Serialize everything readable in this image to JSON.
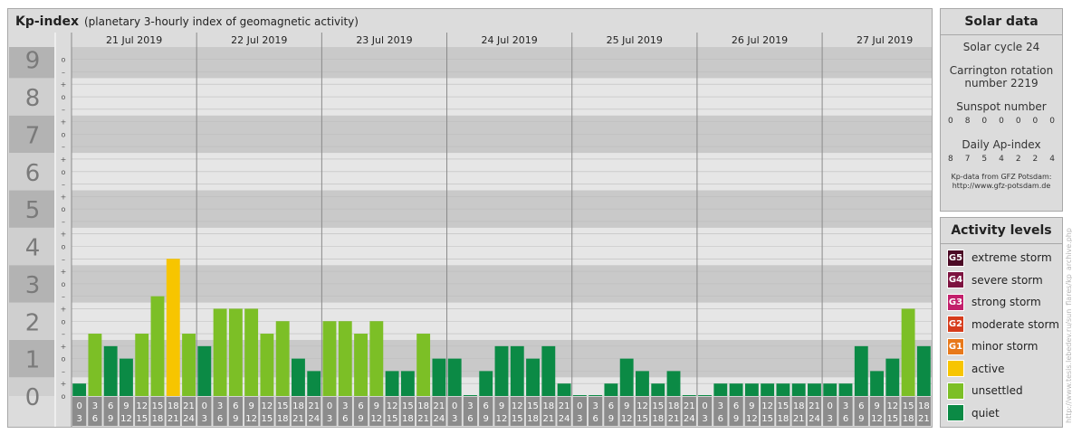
{
  "header": {
    "title": "Kp-index",
    "subtitle": "(planetary 3-hourly index of geomagnetic activity)"
  },
  "chart_data": {
    "type": "bar",
    "y_ticks": [
      "0",
      "1",
      "2",
      "3",
      "4",
      "5",
      "6",
      "7",
      "8",
      "9"
    ],
    "y_minor_labels": [
      "o",
      "+",
      "–"
    ],
    "ylim": [
      0,
      9.33
    ],
    "days": [
      "21 Jul 2019",
      "22 Jul 2019",
      "23 Jul 2019",
      "24 Jul 2019",
      "25 Jul 2019",
      "26 Jul 2019",
      "27 Jul 2019"
    ],
    "bin_start_labels": [
      "0",
      "3",
      "6",
      "9",
      "12",
      "15",
      "18",
      "21"
    ],
    "bin_end_labels": [
      "3",
      "6",
      "9",
      "12",
      "15",
      "18",
      "21",
      "24"
    ],
    "values": [
      0.333,
      1.667,
      1.333,
      1.0,
      1.667,
      2.667,
      3.667,
      1.667,
      1.333,
      2.333,
      2.333,
      2.333,
      1.667,
      2.0,
      1.0,
      0.667,
      2.0,
      2.0,
      1.667,
      2.0,
      0.667,
      0.667,
      1.667,
      1.0,
      1.0,
      0.0,
      0.667,
      1.333,
      1.333,
      1.0,
      1.333,
      0.333,
      0.0,
      0.0,
      0.333,
      1.0,
      0.667,
      0.333,
      0.667,
      0.0,
      0.0,
      0.333,
      0.333,
      0.333,
      0.333,
      0.333,
      0.333,
      0.333,
      0.333,
      0.333,
      1.333,
      0.667,
      1.0,
      2.333,
      1.333
    ],
    "values_note_first_bar": 0.0,
    "colors": {
      "quiet": "#0b8a45",
      "unsettled": "#7cbf26",
      "active": "#f7c500"
    },
    "grid": true
  },
  "solar": {
    "title": "Solar data",
    "solar_cycle": "Solar cycle 24",
    "carrington_line1": "Carrington rotation",
    "carrington_line2": "number 2219",
    "sunspot_label": "Sunspot number",
    "sunspot_values": [
      "0",
      "8",
      "0",
      "0",
      "0",
      "0",
      "0"
    ],
    "ap_label": "Daily Ap-index",
    "ap_values": [
      "8",
      "7",
      "5",
      "4",
      "2",
      "2",
      "4"
    ],
    "source_line1": "Kp-data from GFZ Potsdam:",
    "source_line2": "http://www.gfz-potsdam.de"
  },
  "activity": {
    "title": "Activity levels",
    "levels": [
      {
        "code": "G5",
        "label": "extreme storm",
        "color": "#4b0a25"
      },
      {
        "code": "G4",
        "label": "severe storm",
        "color": "#7d1340"
      },
      {
        "code": "G3",
        "label": "strong storm",
        "color": "#c21f6b"
      },
      {
        "code": "G2",
        "label": "moderate storm",
        "color": "#d63c1c"
      },
      {
        "code": "G1",
        "label": "minor storm",
        "color": "#e8791a"
      },
      {
        "code": "",
        "label": "active",
        "color": "#f7c500"
      },
      {
        "code": "",
        "label": "unsettled",
        "color": "#7cbf26"
      },
      {
        "code": "",
        "label": "quiet",
        "color": "#0b8a45"
      }
    ]
  },
  "watermark": "http://www.tesis.lebedev.ru/sun_flares/kp_archive.php"
}
